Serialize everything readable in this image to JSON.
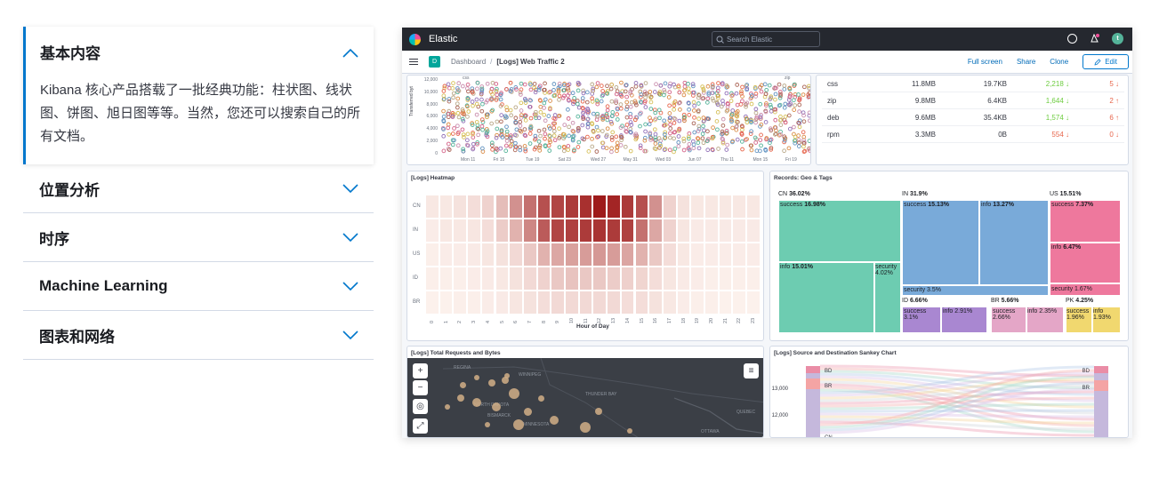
{
  "accordion": {
    "open": {
      "title": "基本内容",
      "body": "Kibana 核心产品搭载了一批经典功能：柱状图、线状图、饼图、旭日图等等。当然，您还可以搜索自己的所有文档。"
    },
    "items": [
      {
        "title": "位置分析"
      },
      {
        "title": "时序"
      },
      {
        "title": "Machine Learning"
      },
      {
        "title": "图表和网络"
      }
    ]
  },
  "kibana": {
    "brand": "Elastic",
    "search_placeholder": "Search Elastic",
    "avatar": "t",
    "dash_badge": "D",
    "breadcrumb": {
      "root": "Dashboard",
      "current": "[Logs] Web Traffic 2"
    },
    "actions": {
      "full_screen": "Full screen",
      "share": "Share",
      "clone": "Clone",
      "edit": "Edit"
    },
    "scatter": {
      "ylabel": "Transferred byt",
      "yticks": [
        "12,000",
        "10,000",
        "8,000",
        "6,000",
        "4,000",
        "2,000",
        "0"
      ],
      "xticks": [
        "Mon 11",
        "Fri 15",
        "Tue 19",
        "Sat 23",
        "Wed 27",
        "May 31",
        "Wed 03",
        "Jun 07",
        "Thu 11",
        "Mon 15",
        "Fri 19"
      ],
      "legend_left": "css",
      "legend_right": "zip"
    },
    "table": {
      "rows": [
        {
          "ext": "css",
          "size": "11.8MB",
          "avg": "19.7KB",
          "count": "2,218",
          "count_dir": "↓",
          "err": "5",
          "err_dir": "↓"
        },
        {
          "ext": "zip",
          "size": "9.8MB",
          "avg": "6.4KB",
          "count": "1,644",
          "count_dir": "↓",
          "err": "2",
          "err_dir": "↑"
        },
        {
          "ext": "deb",
          "size": "9.6MB",
          "avg": "35.4KB",
          "count": "1,574",
          "count_dir": "↓",
          "err": "6",
          "err_dir": "↑"
        },
        {
          "ext": "rpm",
          "size": "3.3MB",
          "avg": "0B",
          "count": "554",
          "count_dir": "↓",
          "err": "0",
          "err_dir": "↓"
        }
      ]
    },
    "heatmap": {
      "title": "[Logs] Heatmap",
      "rows": [
        "CN",
        "IN",
        "US",
        "ID",
        "BR"
      ],
      "hours": [
        "0",
        "1",
        "2",
        "3",
        "4",
        "5",
        "6",
        "7",
        "8",
        "9",
        "10",
        "11",
        "12",
        "13",
        "14",
        "15",
        "16",
        "17",
        "18",
        "19",
        "20",
        "21",
        "22",
        "23"
      ],
      "xlabel": "Hour of Day",
      "colors": {
        "low": "#fdf3ee",
        "high": "#9e1a1a"
      }
    },
    "treemap": {
      "title": "Records: Geo & Tags",
      "cn": {
        "label": "CN",
        "pct": "36.02%",
        "success": "success",
        "success_pct": "16.98%",
        "info": "info",
        "info_pct": "15.01%",
        "security": "security",
        "security_pct": "4.02%"
      },
      "in": {
        "label": "IN",
        "pct": "31.9%",
        "success": "success",
        "success_pct": "15.13%",
        "info": "info",
        "info_pct": "13.27%",
        "security": "security",
        "security_pct": "3.5%"
      },
      "us": {
        "label": "US",
        "pct": "15.51%",
        "success": "success",
        "success_pct": "7.37%",
        "info": "info",
        "info_pct": "6.47%",
        "security": "security",
        "security_pct": "1.67%"
      },
      "id": {
        "label": "ID",
        "pct": "6.66%",
        "success": "success",
        "success_pct": "3.1%",
        "info": "info",
        "info_pct": "2.91%"
      },
      "br": {
        "label": "BR",
        "pct": "5.66%",
        "success": "success",
        "success_pct": "2.66%",
        "info": "info",
        "info_pct": "2.35%"
      },
      "pk": {
        "label": "PK",
        "pct": "4.25%",
        "success": "success",
        "success_pct": "1.96%",
        "info": "info",
        "info_pct": "1.93%"
      },
      "colors": {
        "cn": "#6dccb1",
        "in": "#79aad9",
        "us": "#ee789d",
        "id": "#a987d1",
        "br": "#e4a6c7",
        "pk": "#f1d86f"
      }
    },
    "map": {
      "title": "[Logs] Total Requests and Bytes",
      "labels": [
        "REGINA",
        "WINNIPEG",
        "THUNDER BAY",
        "NORTH DAKOTA",
        "BISMARCK",
        "MINNESOTA",
        "QUEBEC",
        "OTTAWA"
      ]
    },
    "sankey": {
      "title": "[Logs] Source and Destination Sankey Chart",
      "yticks": [
        "13,000",
        "12,000"
      ],
      "left_nodes": [
        "BD",
        "BR"
      ],
      "right_nodes": [
        "BD",
        "BR"
      ],
      "bottom_node": "CN"
    }
  }
}
